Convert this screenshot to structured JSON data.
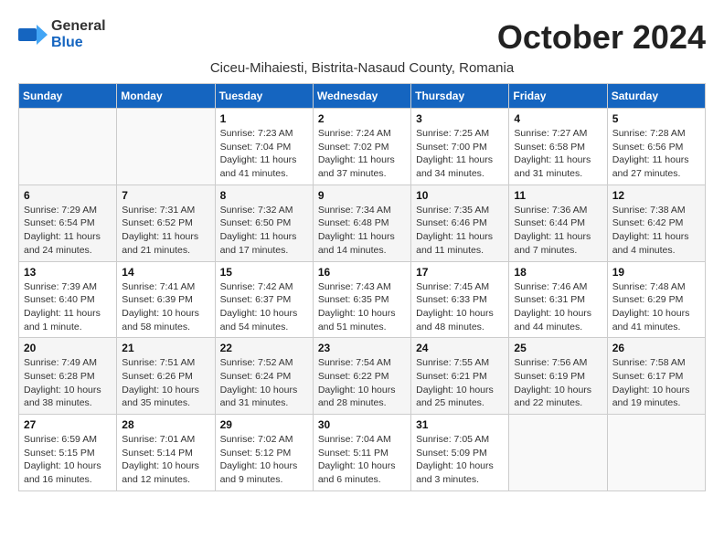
{
  "header": {
    "logo_general": "General",
    "logo_blue": "Blue",
    "month_title": "October 2024",
    "subtitle": "Ciceu-Mihaiesti, Bistrita-Nasaud County, Romania"
  },
  "weekdays": [
    "Sunday",
    "Monday",
    "Tuesday",
    "Wednesday",
    "Thursday",
    "Friday",
    "Saturday"
  ],
  "weeks": [
    [
      {
        "day": "",
        "info": ""
      },
      {
        "day": "",
        "info": ""
      },
      {
        "day": "1",
        "info": "Sunrise: 7:23 AM\nSunset: 7:04 PM\nDaylight: 11 hours and 41 minutes."
      },
      {
        "day": "2",
        "info": "Sunrise: 7:24 AM\nSunset: 7:02 PM\nDaylight: 11 hours and 37 minutes."
      },
      {
        "day": "3",
        "info": "Sunrise: 7:25 AM\nSunset: 7:00 PM\nDaylight: 11 hours and 34 minutes."
      },
      {
        "day": "4",
        "info": "Sunrise: 7:27 AM\nSunset: 6:58 PM\nDaylight: 11 hours and 31 minutes."
      },
      {
        "day": "5",
        "info": "Sunrise: 7:28 AM\nSunset: 6:56 PM\nDaylight: 11 hours and 27 minutes."
      }
    ],
    [
      {
        "day": "6",
        "info": "Sunrise: 7:29 AM\nSunset: 6:54 PM\nDaylight: 11 hours and 24 minutes."
      },
      {
        "day": "7",
        "info": "Sunrise: 7:31 AM\nSunset: 6:52 PM\nDaylight: 11 hours and 21 minutes."
      },
      {
        "day": "8",
        "info": "Sunrise: 7:32 AM\nSunset: 6:50 PM\nDaylight: 11 hours and 17 minutes."
      },
      {
        "day": "9",
        "info": "Sunrise: 7:34 AM\nSunset: 6:48 PM\nDaylight: 11 hours and 14 minutes."
      },
      {
        "day": "10",
        "info": "Sunrise: 7:35 AM\nSunset: 6:46 PM\nDaylight: 11 hours and 11 minutes."
      },
      {
        "day": "11",
        "info": "Sunrise: 7:36 AM\nSunset: 6:44 PM\nDaylight: 11 hours and 7 minutes."
      },
      {
        "day": "12",
        "info": "Sunrise: 7:38 AM\nSunset: 6:42 PM\nDaylight: 11 hours and 4 minutes."
      }
    ],
    [
      {
        "day": "13",
        "info": "Sunrise: 7:39 AM\nSunset: 6:40 PM\nDaylight: 11 hours and 1 minute."
      },
      {
        "day": "14",
        "info": "Sunrise: 7:41 AM\nSunset: 6:39 PM\nDaylight: 10 hours and 58 minutes."
      },
      {
        "day": "15",
        "info": "Sunrise: 7:42 AM\nSunset: 6:37 PM\nDaylight: 10 hours and 54 minutes."
      },
      {
        "day": "16",
        "info": "Sunrise: 7:43 AM\nSunset: 6:35 PM\nDaylight: 10 hours and 51 minutes."
      },
      {
        "day": "17",
        "info": "Sunrise: 7:45 AM\nSunset: 6:33 PM\nDaylight: 10 hours and 48 minutes."
      },
      {
        "day": "18",
        "info": "Sunrise: 7:46 AM\nSunset: 6:31 PM\nDaylight: 10 hours and 44 minutes."
      },
      {
        "day": "19",
        "info": "Sunrise: 7:48 AM\nSunset: 6:29 PM\nDaylight: 10 hours and 41 minutes."
      }
    ],
    [
      {
        "day": "20",
        "info": "Sunrise: 7:49 AM\nSunset: 6:28 PM\nDaylight: 10 hours and 38 minutes."
      },
      {
        "day": "21",
        "info": "Sunrise: 7:51 AM\nSunset: 6:26 PM\nDaylight: 10 hours and 35 minutes."
      },
      {
        "day": "22",
        "info": "Sunrise: 7:52 AM\nSunset: 6:24 PM\nDaylight: 10 hours and 31 minutes."
      },
      {
        "day": "23",
        "info": "Sunrise: 7:54 AM\nSunset: 6:22 PM\nDaylight: 10 hours and 28 minutes."
      },
      {
        "day": "24",
        "info": "Sunrise: 7:55 AM\nSunset: 6:21 PM\nDaylight: 10 hours and 25 minutes."
      },
      {
        "day": "25",
        "info": "Sunrise: 7:56 AM\nSunset: 6:19 PM\nDaylight: 10 hours and 22 minutes."
      },
      {
        "day": "26",
        "info": "Sunrise: 7:58 AM\nSunset: 6:17 PM\nDaylight: 10 hours and 19 minutes."
      }
    ],
    [
      {
        "day": "27",
        "info": "Sunrise: 6:59 AM\nSunset: 5:15 PM\nDaylight: 10 hours and 16 minutes."
      },
      {
        "day": "28",
        "info": "Sunrise: 7:01 AM\nSunset: 5:14 PM\nDaylight: 10 hours and 12 minutes."
      },
      {
        "day": "29",
        "info": "Sunrise: 7:02 AM\nSunset: 5:12 PM\nDaylight: 10 hours and 9 minutes."
      },
      {
        "day": "30",
        "info": "Sunrise: 7:04 AM\nSunset: 5:11 PM\nDaylight: 10 hours and 6 minutes."
      },
      {
        "day": "31",
        "info": "Sunrise: 7:05 AM\nSunset: 5:09 PM\nDaylight: 10 hours and 3 minutes."
      },
      {
        "day": "",
        "info": ""
      },
      {
        "day": "",
        "info": ""
      }
    ]
  ]
}
